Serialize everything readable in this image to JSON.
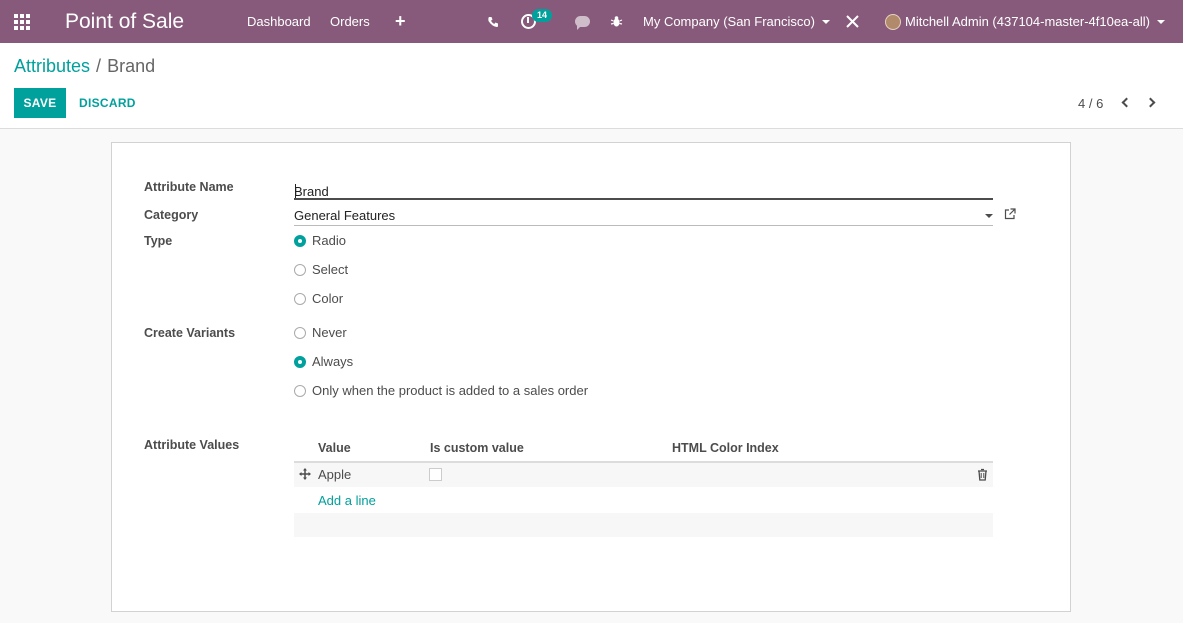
{
  "navbar": {
    "app_title": "Point of Sale",
    "menu": [
      "Dashboard",
      "Orders"
    ],
    "plus_icon": "+",
    "activity_count": "14",
    "company": "My Company (San Francisco)",
    "user": "Mitchell Admin (437104-master-4f10ea-all)",
    "background_color": "#875a7b"
  },
  "breadcrumb": {
    "parent": "Attributes",
    "separator": "/",
    "current": "Brand"
  },
  "actions": {
    "save_label": "SAVE",
    "discard_label": "DISCARD"
  },
  "pager": {
    "value": "4 / 6"
  },
  "form": {
    "attribute_name_label": "Attribute Name",
    "attribute_name_value": "Brand",
    "category_label": "Category",
    "category_value": "General Features",
    "type_label": "Type",
    "type_options": [
      "Radio",
      "Select",
      "Color"
    ],
    "type_selected": "Radio",
    "create_variants_label": "Create Variants",
    "create_variants_options": [
      "Never",
      "Always",
      "Only when the product is added to a sales order"
    ],
    "create_variants_selected": "Always",
    "attribute_values_label": "Attribute Values"
  },
  "values_table": {
    "columns": [
      "Value",
      "Is custom value",
      "HTML Color Index"
    ],
    "rows": [
      {
        "value": "Apple",
        "is_custom_value": false,
        "html_color_index": ""
      }
    ],
    "add_line_label": "Add a line"
  },
  "colors": {
    "accent": "#00a09d",
    "brand": "#875a7b"
  }
}
